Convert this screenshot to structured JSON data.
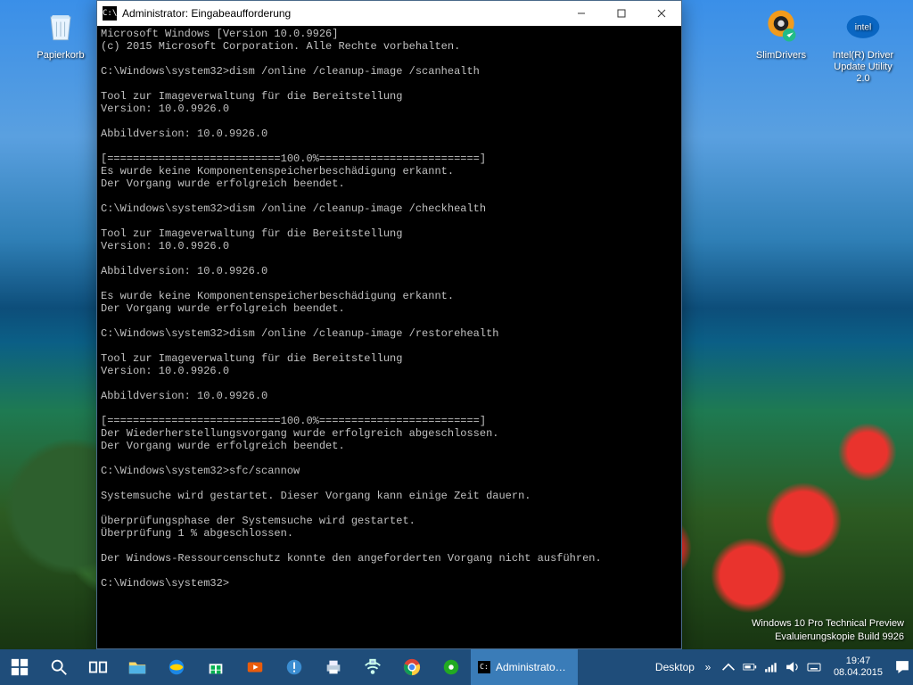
{
  "desktop_icons": {
    "recycle_bin": "Papierkorb",
    "slimdrivers": "SlimDrivers",
    "intel_driver": "Intel(R) Driver Update Utility 2.0"
  },
  "cmd": {
    "title": "Administrator: Eingabeaufforderung",
    "lines": [
      "Microsoft Windows [Version 10.0.9926]",
      "(c) 2015 Microsoft Corporation. Alle Rechte vorbehalten.",
      "",
      "C:\\Windows\\system32>dism /online /cleanup-image /scanhealth",
      "",
      "Tool zur Imageverwaltung für die Bereitstellung",
      "Version: 10.0.9926.0",
      "",
      "Abbildversion: 10.0.9926.0",
      "",
      "[===========================100.0%=========================]",
      "Es wurde keine Komponentenspeicherbeschädigung erkannt.",
      "Der Vorgang wurde erfolgreich beendet.",
      "",
      "C:\\Windows\\system32>dism /online /cleanup-image /checkhealth",
      "",
      "Tool zur Imageverwaltung für die Bereitstellung",
      "Version: 10.0.9926.0",
      "",
      "Abbildversion: 10.0.9926.0",
      "",
      "Es wurde keine Komponentenspeicherbeschädigung erkannt.",
      "Der Vorgang wurde erfolgreich beendet.",
      "",
      "C:\\Windows\\system32>dism /online /cleanup-image /restorehealth",
      "",
      "Tool zur Imageverwaltung für die Bereitstellung",
      "Version: 10.0.9926.0",
      "",
      "Abbildversion: 10.0.9926.0",
      "",
      "[===========================100.0%=========================]",
      "Der Wiederherstellungsvorgang wurde erfolgreich abgeschlossen.",
      "Der Vorgang wurde erfolgreich beendet.",
      "",
      "C:\\Windows\\system32>sfc/scannow",
      "",
      "Systemsuche wird gestartet. Dieser Vorgang kann einige Zeit dauern.",
      "",
      "Überprüfungsphase der Systemsuche wird gestartet.",
      "Überprüfung 1 % abgeschlossen.",
      "",
      "Der Windows-Ressourcenschutz konnte den angeforderten Vorgang nicht ausführen.",
      "",
      "C:\\Windows\\system32>"
    ]
  },
  "watermark": {
    "line1": "Windows 10 Pro Technical Preview",
    "line2": "Evaluierungskopie Build 9926"
  },
  "taskbar": {
    "cmd_task": "Administrato…",
    "desktop_toolbar": "Desktop",
    "time": "19:47",
    "date": "08.04.2015"
  }
}
